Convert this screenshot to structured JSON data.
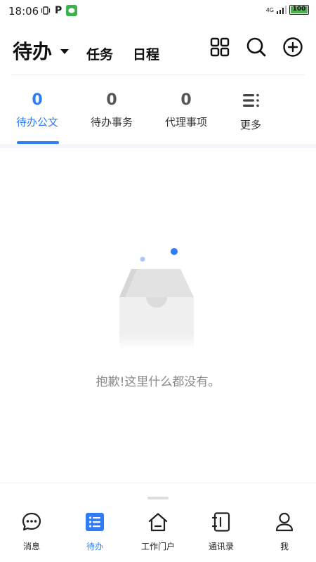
{
  "status_bar": {
    "time": "18:06",
    "network": "4G",
    "battery": "100"
  },
  "header": {
    "title": "待办",
    "tabs": [
      {
        "label": "任务"
      },
      {
        "label": "日程"
      }
    ],
    "icons": [
      "grid-icon",
      "search-icon",
      "add-circle-icon"
    ]
  },
  "subtabs": [
    {
      "count": "0",
      "label": "待办公文",
      "active": true
    },
    {
      "count": "0",
      "label": "待办事务",
      "active": false
    },
    {
      "count": "0",
      "label": "代理事项",
      "active": false
    },
    {
      "icon": "more-list-icon",
      "label": "更多",
      "active": false
    }
  ],
  "empty_state": {
    "message": "抱歉!这里什么都没有。",
    "icon": "empty-box-icon"
  },
  "bottom_nav": [
    {
      "label": "消息",
      "icon": "chat-bubble-icon",
      "active": false
    },
    {
      "label": "待办",
      "icon": "list-icon",
      "active": true
    },
    {
      "label": "工作门户",
      "icon": "home-icon",
      "active": false
    },
    {
      "label": "通讯录",
      "icon": "contacts-book-icon",
      "active": false
    },
    {
      "label": "我",
      "icon": "person-icon",
      "active": false
    }
  ],
  "colors": {
    "accent": "#2f7cf6",
    "text_muted": "#8a8a8a"
  }
}
